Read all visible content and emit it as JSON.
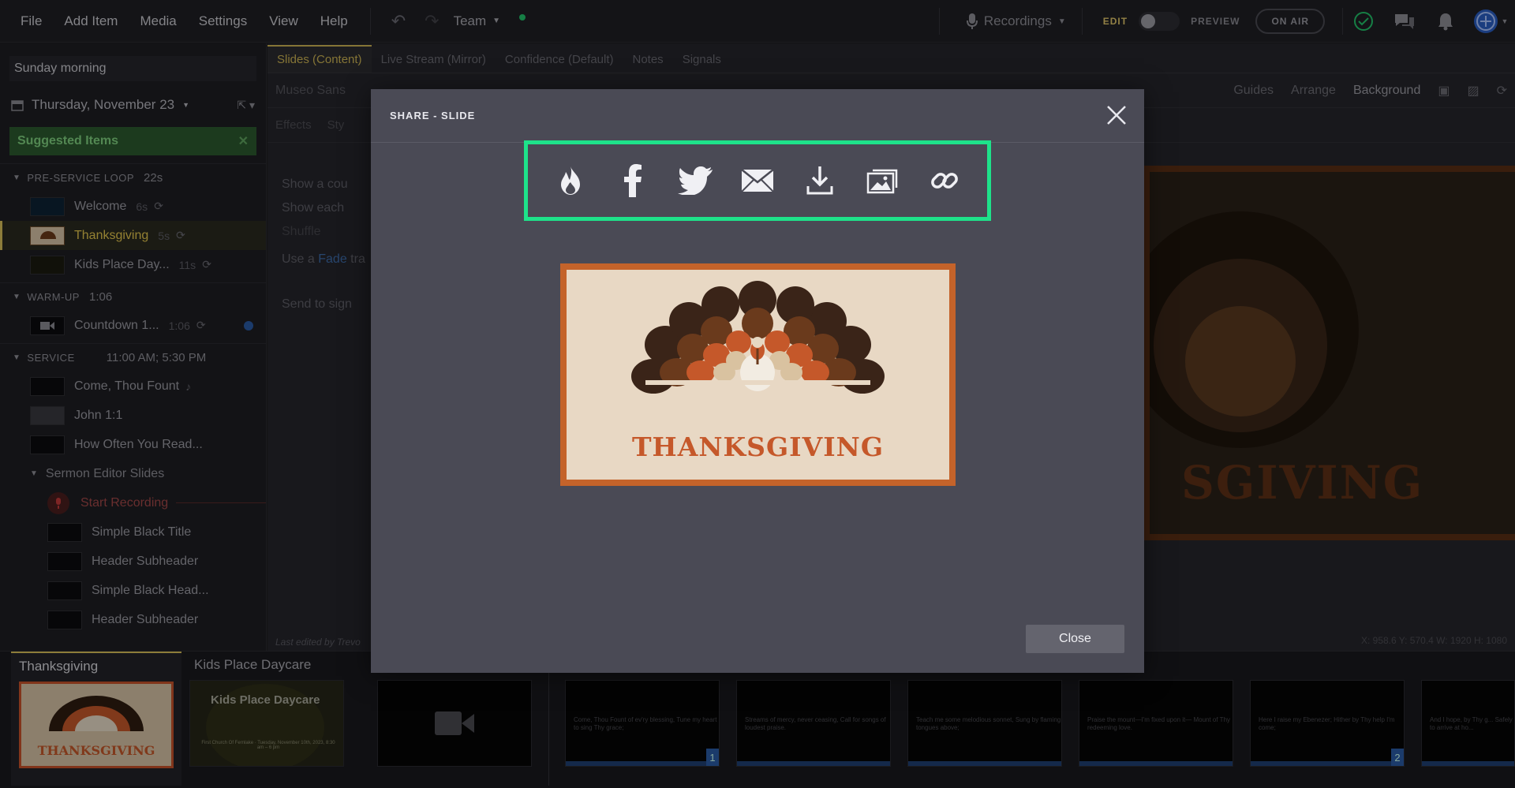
{
  "menu": [
    "File",
    "Add Item",
    "Media",
    "Settings",
    "View",
    "Help"
  ],
  "team": "Team",
  "recordings": "Recordings",
  "edit_label": "EDIT",
  "preview_label": "PREVIEW",
  "on_air": "ON AIR",
  "sidebar": {
    "service_title": "Sunday morning",
    "date": "Thursday, November 23",
    "suggested": "Suggested Items",
    "sections": [
      {
        "name": "PRE-SERVICE LOOP",
        "duration": "22s"
      },
      {
        "name": "WARM-UP",
        "duration": "1:06"
      },
      {
        "name": "SERVICE",
        "duration": "11:00 AM; 5:30 PM"
      }
    ],
    "preservice_items": [
      {
        "label": "Welcome",
        "duration": "6s"
      },
      {
        "label": "Thanksgiving",
        "duration": "5s"
      },
      {
        "label": "Kids Place Day...",
        "duration": "11s"
      }
    ],
    "warmup_items": [
      {
        "label": "Countdown 1...",
        "duration": "1:06"
      }
    ],
    "service_items": [
      "Come, Thou Fount",
      "John 1:1",
      "How Often You Read..."
    ],
    "sermon_group": "Sermon Editor Slides",
    "start_recording": "Start Recording",
    "sermon_items": [
      "Simple Black Title",
      "Header Subheader",
      "Simple Black Head...",
      "Header Subheader"
    ]
  },
  "editor": {
    "tabs": [
      "Slides (Content)",
      "Live Stream (Mirror)",
      "Confidence (Default)",
      "Notes",
      "Signals"
    ],
    "font": "Museo Sans",
    "guides": "Guides",
    "arrange": "Arrange",
    "background": "Background",
    "effects": "Effects",
    "style": "Sty",
    "show_count": "Show a cou",
    "show_each": "Show each",
    "shuffle": "Shuffle",
    "use_a": "Use a",
    "fade": "Fade",
    "tra": "tra",
    "send_to_sign": "Send to sign",
    "last_edited": "Last edited by Trevo",
    "coords": "X: 958.6  Y: 570.4    W: 1920  H: 1080",
    "big_word": "SGIVING"
  },
  "filmstrip": {
    "groups": [
      "Thanksgiving",
      "Kids Place Daycare"
    ],
    "thumb_word": "THANKSGIVING",
    "kids_title": "Kids Place Daycare",
    "kids_sub": "First Church Of Fernlake · Tuesday, November 10th, 2023, 8:30 am – 6 pm",
    "lyrics": [
      "Come, Thou Fount of ev'ry blessing, Tune my heart to sing Thy grace;",
      "Streams of mercy, never ceasing, Call for songs of loudest praise.",
      "Teach me some melodious sonnet, Sung by flaming tongues above;",
      "Praise the mount—I'm fixed upon it— Mount of Thy redeeming love.",
      "Here I raise my Ebenezer; Hither by Thy help I'm come;",
      "And I hope, by Thy g... Safely to arrive at ho..."
    ],
    "num1": "1",
    "num2": "2"
  },
  "modal": {
    "title": "SHARE - SLIDE",
    "share_buttons": [
      "flame-icon",
      "facebook-icon",
      "twitter-icon",
      "email-icon",
      "download-icon",
      "image-icon",
      "link-icon"
    ],
    "preview_word": "THANKSGIVING",
    "close_label": "Close"
  },
  "colors": {
    "highlight": "#1ee28a",
    "accent_gold": "#d9c15a",
    "slide_orange": "#c5582a"
  }
}
